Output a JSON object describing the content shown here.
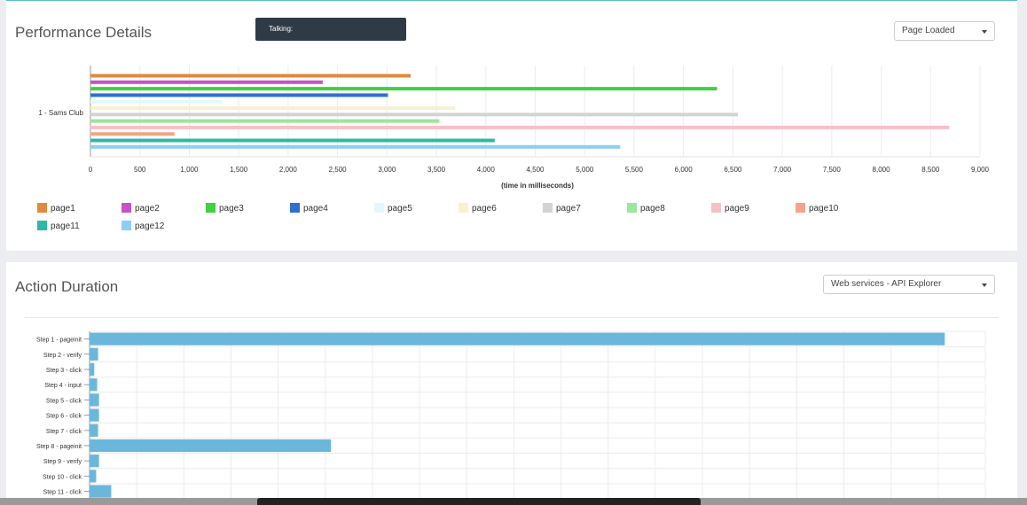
{
  "toast": {
    "text": "Talking:"
  },
  "performance": {
    "title": "Performance Details",
    "dropdown": "Page Loaded",
    "chart_data": {
      "type": "bar",
      "orientation": "horizontal",
      "categories": [
        "1 - Sams Club"
      ],
      "xlabel": "(time in milliseconds)",
      "xlim": [
        0,
        9000
      ],
      "xticks": [
        0,
        500,
        1000,
        1500,
        2000,
        2500,
        3000,
        3500,
        4000,
        4500,
        5000,
        5500,
        6000,
        6500,
        7000,
        7500,
        8000,
        8500,
        9000
      ],
      "xtick_labels": [
        "0",
        "500",
        "1,000",
        "1,500",
        "2,000",
        "2,500",
        "3,000",
        "3,500",
        "4,000",
        "4,500",
        "5,000",
        "5,500",
        "6,000",
        "6,500",
        "7,000",
        "7,500",
        "8,000",
        "8,500",
        "9,000"
      ],
      "legend_placement": "bottom",
      "series": [
        {
          "name": "page1",
          "values": [
            3240
          ],
          "color": "#e08a3c"
        },
        {
          "name": "page2",
          "values": [
            2350
          ],
          "color": "#c452c9"
        },
        {
          "name": "page3",
          "values": [
            6340
          ],
          "color": "#3fd13f"
        },
        {
          "name": "page4",
          "values": [
            3010
          ],
          "color": "#2f6fd1"
        },
        {
          "name": "page5",
          "values": [
            1330
          ],
          "color": "#e4f8fc"
        },
        {
          "name": "page6",
          "values": [
            3690
          ],
          "color": "#f7f1d2"
        },
        {
          "name": "page7",
          "values": [
            6550
          ],
          "color": "#d3d3d3"
        },
        {
          "name": "page8",
          "values": [
            3530
          ],
          "color": "#9ae69a"
        },
        {
          "name": "page9",
          "values": [
            8690
          ],
          "color": "#f7c0c6"
        },
        {
          "name": "page10",
          "values": [
            850
          ],
          "color": "#f4a487"
        },
        {
          "name": "page11",
          "values": [
            4090
          ],
          "color": "#2eb8a6"
        },
        {
          "name": "page12",
          "values": [
            5360
          ],
          "color": "#8fcdf2"
        }
      ]
    }
  },
  "action": {
    "title": "Action Duration",
    "dropdown": "Web services - API Explorer",
    "chart_data": {
      "type": "bar",
      "orientation": "horizontal",
      "categories": [
        "Step 1 - pageinit",
        "Step 2 - verify",
        "Step 3 - click",
        "Step 4 - input",
        "Step 5 - click",
        "Step 6 - click",
        "Step 7 - click",
        "Step 8 - pageinit",
        "Step 9 - verify",
        "Step 10 - click",
        "Step 11 - click"
      ],
      "values": [
        9070,
        90,
        50,
        80,
        100,
        100,
        90,
        2560,
        100,
        70,
        230
      ],
      "xlim": [
        0,
        9500
      ],
      "gridlines": [
        500,
        1000,
        1500,
        2000,
        2500,
        3000,
        3500,
        4000,
        4500,
        5000,
        5500,
        6000,
        6500,
        7000,
        7500,
        8000,
        8500,
        9000,
        9500
      ],
      "grid": true,
      "color": "#6ab7db"
    }
  }
}
